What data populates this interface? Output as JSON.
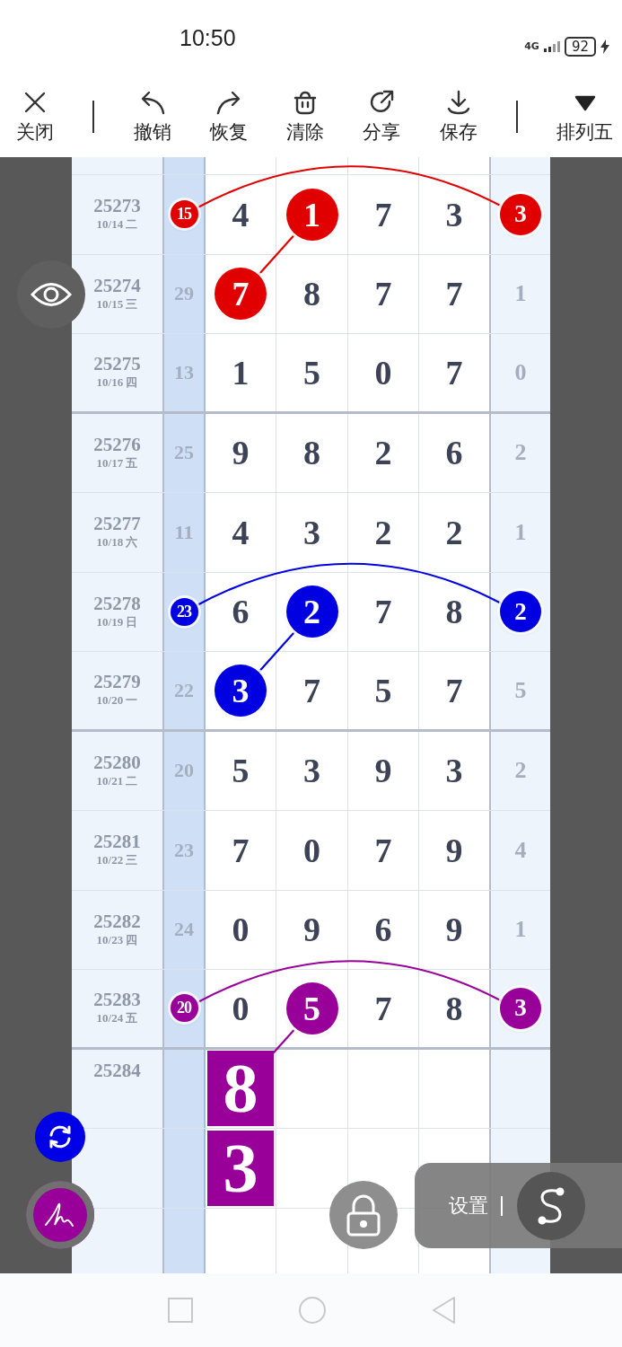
{
  "status_bar": {
    "time": "10:50",
    "network": "4G",
    "battery": "92"
  },
  "toolbar": [
    {
      "label": "关闭"
    },
    {
      "label": "撤销"
    },
    {
      "label": "恢复"
    },
    {
      "label": "清除"
    },
    {
      "label": "分享"
    },
    {
      "label": "保存"
    },
    {
      "label": "排列五"
    }
  ],
  "rows": [
    {
      "issue": "25273",
      "date": "10/14 二",
      "sum": {
        "text": "15",
        "color": "#e00000",
        "kind": "ball"
      },
      "digits": [
        {
          "text": "4"
        },
        {
          "text": "1",
          "color": "#e00000",
          "kind": "ball"
        },
        {
          "text": "7"
        },
        {
          "text": "3"
        }
      ],
      "last": {
        "text": "3",
        "color": "#e00000",
        "kind": "ball"
      },
      "divider_below": false
    },
    {
      "issue": "25274",
      "date": "10/15 三",
      "sum": {
        "text": "29"
      },
      "digits": [
        {
          "text": "7",
          "color": "#e00000",
          "kind": "ball"
        },
        {
          "text": "8"
        },
        {
          "text": "7"
        },
        {
          "text": "7"
        }
      ],
      "last": {
        "text": "1"
      },
      "divider_below": false
    },
    {
      "issue": "25275",
      "date": "10/16 四",
      "sum": {
        "text": "13"
      },
      "digits": [
        {
          "text": "1"
        },
        {
          "text": "5"
        },
        {
          "text": "0"
        },
        {
          "text": "7"
        }
      ],
      "last": {
        "text": "0"
      },
      "divider_below": true
    },
    {
      "issue": "25276",
      "date": "10/17 五",
      "sum": {
        "text": "25"
      },
      "digits": [
        {
          "text": "9"
        },
        {
          "text": "8"
        },
        {
          "text": "2"
        },
        {
          "text": "6"
        }
      ],
      "last": {
        "text": "2"
      },
      "divider_below": false
    },
    {
      "issue": "25277",
      "date": "10/18 六",
      "sum": {
        "text": "11"
      },
      "digits": [
        {
          "text": "4"
        },
        {
          "text": "3"
        },
        {
          "text": "2"
        },
        {
          "text": "2"
        }
      ],
      "last": {
        "text": "1"
      },
      "divider_below": false
    },
    {
      "issue": "25278",
      "date": "10/19 日",
      "sum": {
        "text": "23",
        "color": "#0000e0",
        "kind": "ball"
      },
      "digits": [
        {
          "text": "6"
        },
        {
          "text": "2",
          "color": "#0000e0",
          "kind": "ball"
        },
        {
          "text": "7"
        },
        {
          "text": "8"
        }
      ],
      "last": {
        "text": "2",
        "color": "#0000e0",
        "kind": "ball"
      },
      "divider_below": false
    },
    {
      "issue": "25279",
      "date": "10/20 一",
      "sum": {
        "text": "22"
      },
      "digits": [
        {
          "text": "3",
          "color": "#0000e0",
          "kind": "ball"
        },
        {
          "text": "7"
        },
        {
          "text": "5"
        },
        {
          "text": "7"
        }
      ],
      "last": {
        "text": "5"
      },
      "divider_below": true
    },
    {
      "issue": "25280",
      "date": "10/21 二",
      "sum": {
        "text": "20"
      },
      "digits": [
        {
          "text": "5"
        },
        {
          "text": "3"
        },
        {
          "text": "9"
        },
        {
          "text": "3"
        }
      ],
      "last": {
        "text": "2"
      },
      "divider_below": false
    },
    {
      "issue": "25281",
      "date": "10/22 三",
      "sum": {
        "text": "23"
      },
      "digits": [
        {
          "text": "7"
        },
        {
          "text": "0"
        },
        {
          "text": "7"
        },
        {
          "text": "9"
        }
      ],
      "last": {
        "text": "4"
      },
      "divider_below": false
    },
    {
      "issue": "25282",
      "date": "10/23 四",
      "sum": {
        "text": "24"
      },
      "digits": [
        {
          "text": "0"
        },
        {
          "text": "9"
        },
        {
          "text": "6"
        },
        {
          "text": "9"
        }
      ],
      "last": {
        "text": "1"
      },
      "divider_below": false
    },
    {
      "issue": "25283",
      "date": "10/24 五",
      "sum": {
        "text": "20",
        "color": "#990099",
        "kind": "ball"
      },
      "digits": [
        {
          "text": "0"
        },
        {
          "text": "5",
          "color": "#990099",
          "kind": "ball"
        },
        {
          "text": "7"
        },
        {
          "text": "8"
        }
      ],
      "last": {
        "text": "3",
        "color": "#990099",
        "kind": "ball"
      },
      "divider_below": true
    },
    {
      "issue": "25284",
      "digits": [
        {
          "text": "8",
          "color": "#990099",
          "kind": "square"
        }
      ],
      "divider_below": false
    },
    {
      "digits": [
        {
          "text": "3",
          "color": "#990099",
          "kind": "square"
        }
      ],
      "divider_below": false
    }
  ],
  "settings": {
    "label": "设置"
  }
}
